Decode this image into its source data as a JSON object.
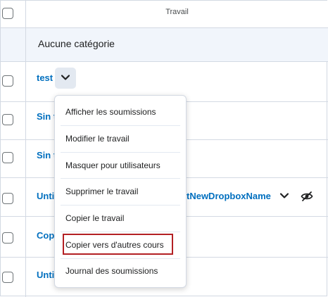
{
  "table": {
    "column_header": "Travail",
    "category": "Aucune catégorie",
    "rows": [
      {
        "name": "test"
      },
      {
        "name": "Sin t"
      },
      {
        "name": "Sin t"
      },
      {
        "name": "Unti"
      },
      {
        "name": "Copi"
      },
      {
        "name": "Unti"
      }
    ],
    "row4_extra_link": "tNewDropboxName"
  },
  "menu": {
    "items": [
      {
        "label": "Afficher les soumissions"
      },
      {
        "label": "Modifier le travail"
      },
      {
        "label": "Masquer pour utilisateurs"
      },
      {
        "label": "Supprimer le travail"
      },
      {
        "label": "Copier le travail"
      },
      {
        "label": "Copier vers d'autres cours"
      },
      {
        "label": "Journal des soumissions"
      }
    ]
  },
  "colors": {
    "link": "#006fbf",
    "highlight": "#b32024",
    "category_bg": "#f1f5fb",
    "border": "#d3d9e3"
  }
}
